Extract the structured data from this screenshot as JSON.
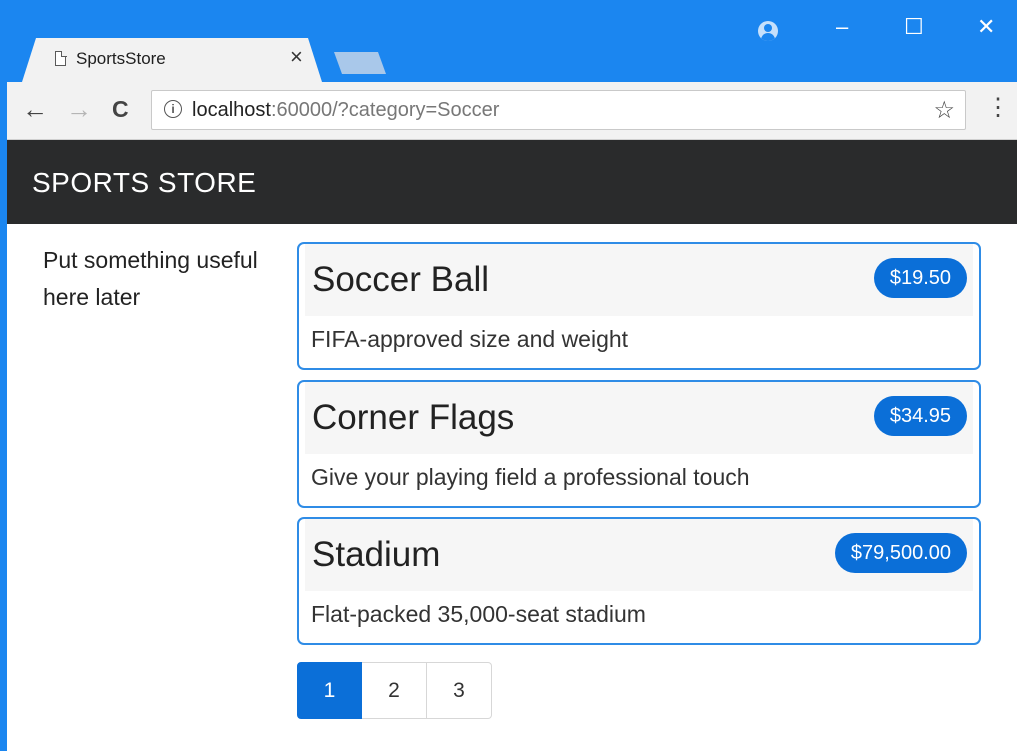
{
  "browser": {
    "tab_title": "SportsStore",
    "tab_close": "×",
    "back_icon": "←",
    "forward_icon": "→",
    "reload_icon": "C",
    "url_host": "localhost",
    "url_rest": ":60000/?category=Soccer",
    "info_icon": "i",
    "star_icon": "☆",
    "menu_icon": "⋮",
    "minimize": "–",
    "maximize": "☐",
    "close": "✕"
  },
  "navbar": {
    "brand": "SPORTS STORE"
  },
  "sidebar": {
    "text": "Put something useful here later"
  },
  "products": [
    {
      "name": "Soccer Ball",
      "price": "$19.50",
      "description": "FIFA-approved size and weight"
    },
    {
      "name": "Corner Flags",
      "price": "$34.95",
      "description": "Give your playing field a professional touch"
    },
    {
      "name": "Stadium",
      "price": "$79,500.00",
      "description": "Flat-packed 35,000-seat stadium"
    }
  ],
  "pagination": {
    "pages": [
      "1",
      "2",
      "3"
    ],
    "current": "1"
  },
  "colors": {
    "chrome_blue": "#1b86f0",
    "navbar_dark": "#2a2b2c",
    "accent": "#0b6fd8",
    "card_border": "#2f8ce6"
  }
}
